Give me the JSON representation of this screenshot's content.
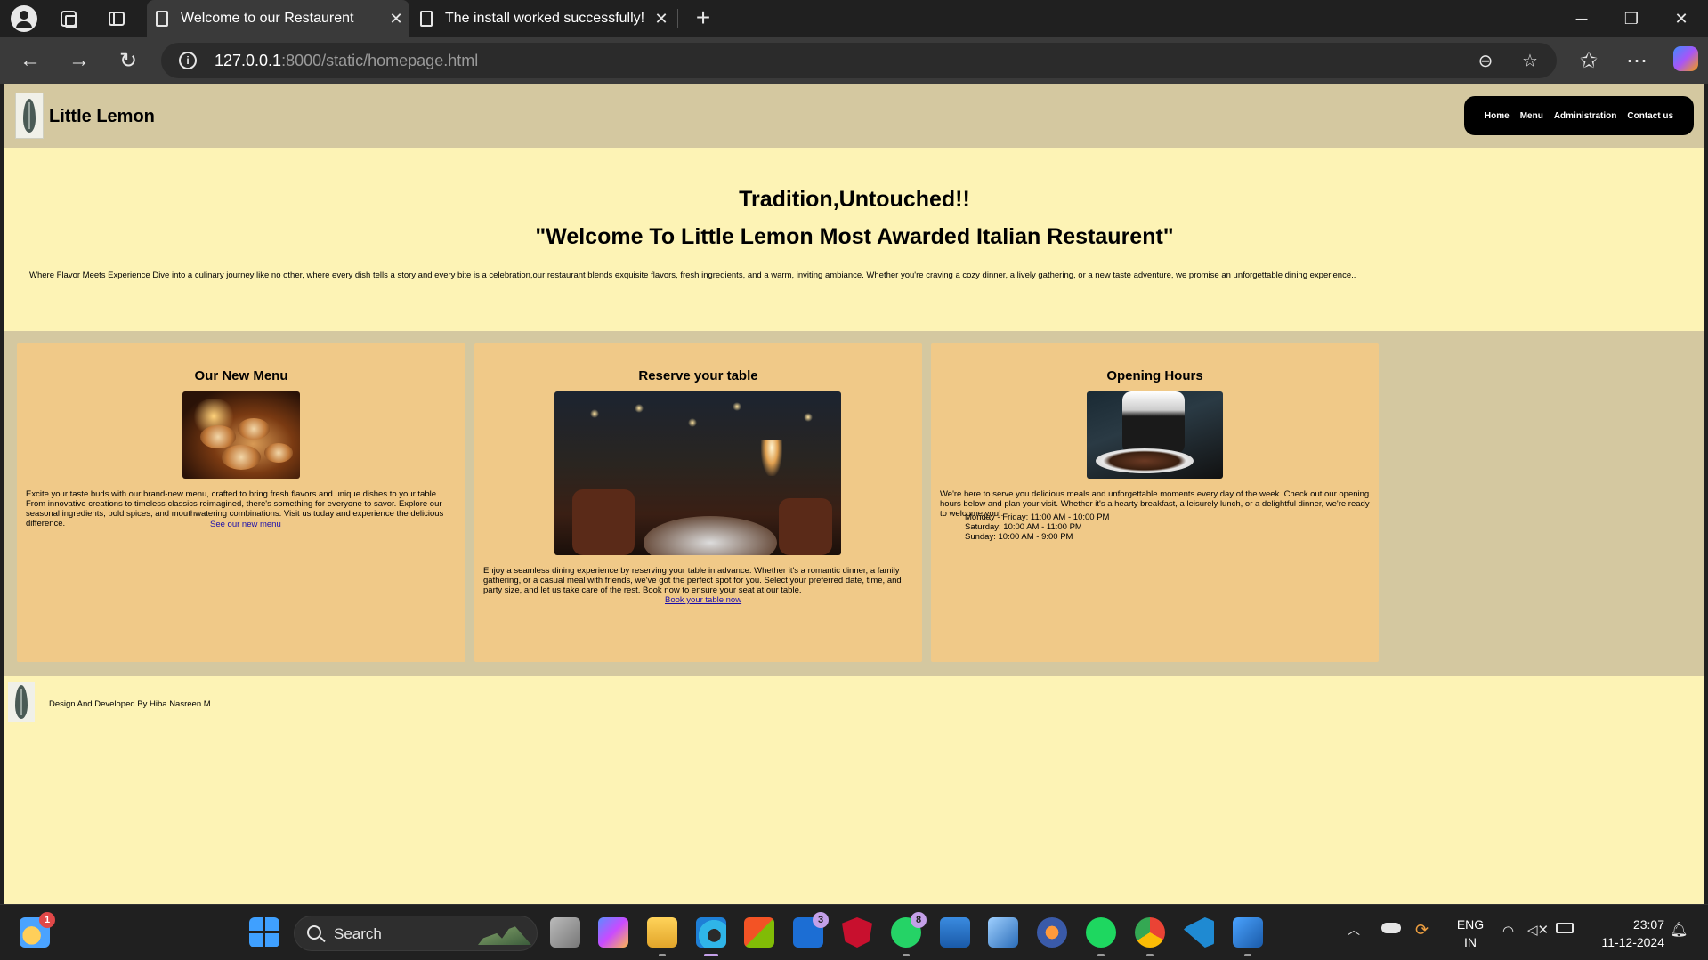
{
  "browser": {
    "tabs": [
      {
        "title": "Welcome to our Restaurent",
        "active": true
      },
      {
        "title": "The install worked successfully! Co",
        "active": false
      }
    ],
    "url_host": "127.0.0.1",
    "url_rest": ":8000/static/homepage.html"
  },
  "site": {
    "brand": "Little Lemon",
    "nav": [
      "Home",
      "Menu",
      "Administration",
      "Contact us"
    ],
    "hero": {
      "tagline": "Tradition,Untouched!!",
      "welcome": "\"Welcome To Little Lemon Most Awarded Italian Restaurent\"",
      "intro": "Where Flavor Meets Experience Dive into a culinary journey like no other, where every dish tells a story and every bite is a celebration,our restaurant blends exquisite flavors, fresh ingredients, and a warm, inviting ambiance. Whether you're craving a cozy dinner, a lively gathering, or a new taste adventure, we promise an unforgettable dining experience.."
    },
    "cards": {
      "menu": {
        "title": "Our New Menu",
        "text": "Excite your taste buds with our brand-new menu, crafted to bring fresh flavors and unique dishes to your table. From innovative creations to timeless classics reimagined, there's something for everyone to savor. Explore our seasonal ingredients, bold spices, and mouthwatering combinations. Visit us today and experience the delicious difference.",
        "link": "See our new menu"
      },
      "reserve": {
        "title": "Reserve your table",
        "text": "Enjoy a seamless dining experience by reserving your table in advance. Whether it's a romantic dinner, a family gathering, or a casual meal with friends, we've got the perfect spot for you. Select your preferred date, time, and party size, and let us take care of the rest. Book now to ensure your seat at our table.",
        "link": "Book your table now"
      },
      "hours": {
        "title": "Opening Hours",
        "text": "We're here to serve you delicious meals and unforgettable moments every day of the week. Check out our opening hours below and plan your visit. Whether it's a hearty breakfast, a leisurely lunch, or a delightful dinner, we're ready to welcome you!.",
        "schedule": [
          "Monday - Friday: 11:00 AM - 10:00 PM",
          "Saturday: 10:00 AM - 11:00 PM",
          "Sunday: 10:00 AM - 9:00 PM"
        ]
      }
    },
    "footer": "Design And Developed By Hiba Nasreen M"
  },
  "taskbar": {
    "search_label": "Search",
    "badges": {
      "weather": "1",
      "teams": "3",
      "whatsapp": "8"
    },
    "lang_line1": "ENG",
    "lang_line2": "IN",
    "time": "23:07",
    "date": "11-12-2024"
  },
  "colors": {
    "page_bg": "#fdf3b5",
    "header_bg": "#d4c8a0",
    "card_bg": "#f0c988",
    "nav_bg": "#000000"
  }
}
